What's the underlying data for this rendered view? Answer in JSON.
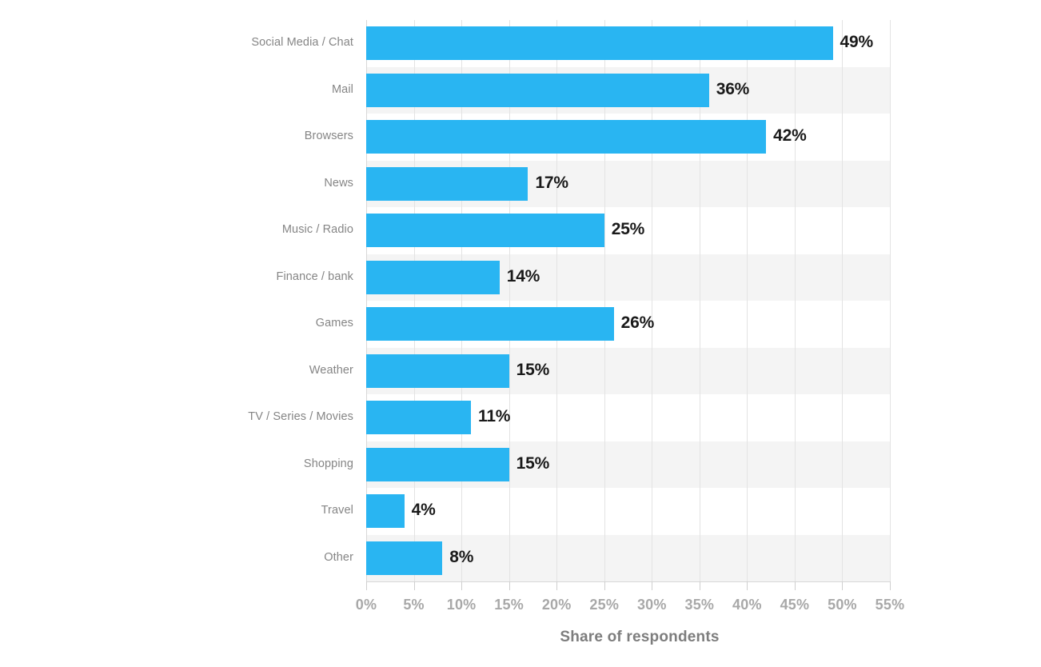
{
  "chart_data": {
    "type": "bar",
    "orientation": "horizontal",
    "title": "",
    "subtitle": "",
    "xlabel": "Share of respondents",
    "ylabel": "",
    "categories": [
      "Social Media / Chat",
      "Mail",
      "Browsers",
      "News",
      "Music / Radio",
      "Finance / bank",
      "Games",
      "Weather",
      "TV / Series / Movies",
      "Shopping",
      "Travel",
      "Other"
    ],
    "values": [
      49,
      36,
      42,
      17,
      25,
      14,
      26,
      15,
      11,
      15,
      4,
      8
    ],
    "value_labels": [
      "49%",
      "36%",
      "42%",
      "17%",
      "25%",
      "14%",
      "26%",
      "15%",
      "11%",
      "15%",
      "4%",
      "8%"
    ],
    "xticks": [
      0,
      5,
      10,
      15,
      20,
      25,
      30,
      35,
      40,
      45,
      50,
      55
    ],
    "xtick_labels": [
      "0%",
      "5%",
      "10%",
      "15%",
      "20%",
      "25%",
      "30%",
      "35%",
      "40%",
      "45%",
      "50%",
      "55%"
    ],
    "xlim": [
      0,
      55
    ],
    "grid": "vertical",
    "legend": "none",
    "bar_color": "#29b5f2",
    "band_color": "#f4f4f4",
    "gridline_color": "#e3e3e3",
    "label_color": "#1a1a1a",
    "tick_color": "#a8a8a8",
    "category_color": "#858585",
    "axis_title_color": "#7d7d7d",
    "background": "#ffffff"
  }
}
